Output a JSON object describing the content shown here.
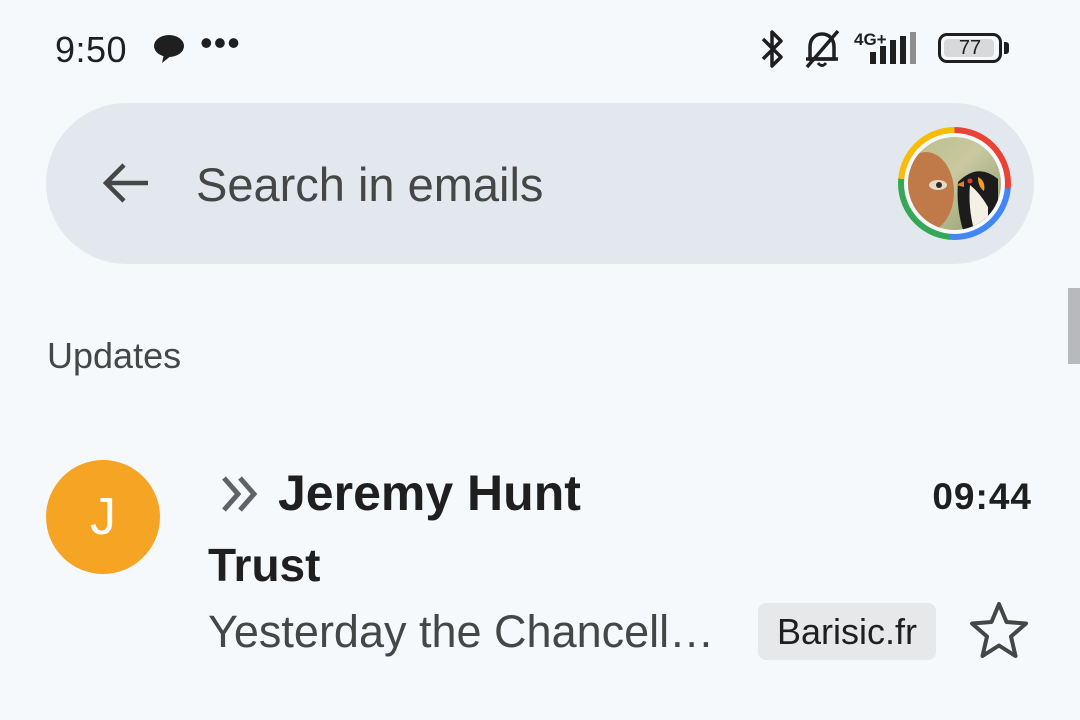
{
  "status_bar": {
    "time": "9:50",
    "dots": "•••",
    "network": "4G+",
    "battery": "77",
    "icons": [
      "message-icon",
      "bluetooth-icon",
      "bell-off-icon",
      "signal-icon",
      "battery-icon"
    ]
  },
  "search": {
    "placeholder": "Search in emails"
  },
  "section": {
    "title": "Updates"
  },
  "emails": [
    {
      "avatar_letter": "J",
      "avatar_color": "#f6a423",
      "sender": "Jeremy Hunt",
      "time": "09:44",
      "subject": "Trust",
      "snippet": "Yesterday the Chancellor ...",
      "label": "Barisic.fr",
      "starred": false
    }
  ],
  "colors": {
    "background": "#f6f9fc",
    "search_bar": "#e3e8ee",
    "text_secondary": "#444746"
  }
}
